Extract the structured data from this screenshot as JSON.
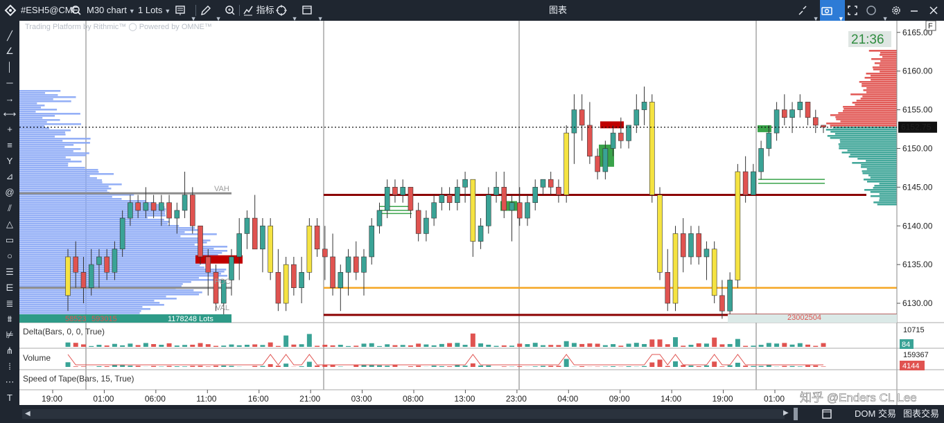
{
  "toolbar": {
    "symbol": "#ESH5@CME",
    "timeframe": "M30 chart",
    "lots": "1 Lots",
    "indicators_label": "指标"
  },
  "window": {
    "title": "图表"
  },
  "chart": {
    "watermark": "Trading Platform by Rithmic™  ◯ Powered by OMNE™",
    "f_label": "F",
    "bar_timer": "21:36",
    "current_price_label": "6152.75",
    "current_price": 6152.75,
    "price_axis": {
      "min": 6127.5,
      "max": 6166.5,
      "ticks": [
        "6165.00",
        "6160.00",
        "6155.00",
        "6150.00",
        "6145.00",
        "6140.00",
        "6135.00",
        "6130.00"
      ]
    },
    "time_axis": [
      "19:00",
      "01:00",
      "06:00",
      "11:00",
      "16:00",
      "21:00",
      "03:00",
      "08:00",
      "13:00",
      "23:00",
      "04:00",
      "09:00",
      "14:00",
      "19:00",
      "01:00"
    ],
    "profile_labels": {
      "vah": "VAH",
      "poc": "POC",
      "val": "VAL"
    },
    "profile_footer": {
      "left": "58523",
      "right": "1178248 Lots"
    },
    "session_footer": "23002504",
    "levels": [
      {
        "name": "VAH",
        "price": 6144.0,
        "color": "#8c8c8c"
      },
      {
        "name": "POC",
        "price": 6132.0,
        "color": "#8c8c8c"
      },
      {
        "name": "res-1",
        "price": 6144.0,
        "color": "#8b0000"
      },
      {
        "name": "sup-1",
        "price": 6128.5,
        "color": "#8b0000"
      },
      {
        "name": "orange",
        "price": 6132.0,
        "color": "#f5a623"
      }
    ],
    "colors": {
      "up": "#3aa396",
      "down": "#e05350",
      "yellow": "#f5e342",
      "profile": "#8aa7f5"
    }
  },
  "chart_data": {
    "type": "candlestick",
    "title": "#ESH5@CME M30 chart",
    "ylim": [
      6127.5,
      6166.5
    ],
    "candles": [
      {
        "t": "19:00",
        "o": 6131,
        "h": 6137,
        "l": 6129,
        "c": 6136
      },
      {
        "t": "19:30",
        "o": 6136,
        "h": 6138,
        "l": 6132,
        "c": 6134
      },
      {
        "t": "20:00",
        "o": 6134,
        "h": 6136,
        "l": 6130,
        "c": 6132
      },
      {
        "t": "20:30",
        "o": 6132,
        "h": 6137,
        "l": 6131,
        "c": 6135
      },
      {
        "t": "21:00",
        "o": 6135,
        "h": 6137,
        "l": 6132,
        "c": 6136
      },
      {
        "t": "21:30",
        "o": 6136,
        "h": 6137,
        "l": 6133,
        "c": 6134
      },
      {
        "t": "22:00",
        "o": 6134,
        "h": 6138,
        "l": 6133,
        "c": 6137
      },
      {
        "t": "22:30",
        "o": 6137,
        "h": 6142,
        "l": 6136,
        "c": 6141
      },
      {
        "t": "23:00",
        "o": 6141,
        "h": 6144,
        "l": 6140,
        "c": 6143
      },
      {
        "t": "23:30",
        "o": 6143,
        "h": 6144,
        "l": 6141,
        "c": 6142
      },
      {
        "t": "00:00",
        "o": 6142,
        "h": 6145,
        "l": 6141,
        "c": 6143
      },
      {
        "t": "00:30",
        "o": 6143,
        "h": 6144,
        "l": 6141,
        "c": 6142
      },
      {
        "t": "01:00",
        "o": 6142,
        "h": 6144,
        "l": 6140,
        "c": 6143
      },
      {
        "t": "01:30",
        "o": 6143,
        "h": 6144,
        "l": 6140,
        "c": 6141
      },
      {
        "t": "02:00",
        "o": 6141,
        "h": 6143,
        "l": 6139,
        "c": 6142
      },
      {
        "t": "02:30",
        "o": 6142,
        "h": 6147,
        "l": 6141,
        "c": 6144
      },
      {
        "t": "03:00",
        "o": 6144,
        "h": 6145,
        "l": 6139,
        "c": 6140
      },
      {
        "t": "03:30",
        "o": 6140,
        "h": 6140,
        "l": 6135,
        "c": 6136
      },
      {
        "t": "04:00",
        "o": 6136,
        "h": 6137,
        "l": 6131,
        "c": 6134
      },
      {
        "t": "04:30",
        "o": 6134,
        "h": 6135,
        "l": 6129,
        "c": 6130
      },
      {
        "t": "05:00",
        "o": 6130,
        "h": 6133,
        "l": 6128,
        "c": 6133
      },
      {
        "t": "05:30",
        "o": 6133,
        "h": 6137,
        "l": 6131,
        "c": 6136
      },
      {
        "t": "06:00",
        "o": 6136,
        "h": 6141,
        "l": 6133,
        "c": 6139
      },
      {
        "t": "06:30",
        "o": 6139,
        "h": 6142,
        "l": 6137,
        "c": 6141
      },
      {
        "t": "07:00",
        "o": 6141,
        "h": 6144,
        "l": 6137,
        "c": 6137
      },
      {
        "t": "07:30",
        "o": 6137,
        "h": 6141,
        "l": 6134,
        "c": 6140
      },
      {
        "t": "08:00",
        "o": 6140,
        "h": 6141,
        "l": 6133,
        "c": 6134
      },
      {
        "t": "08:30",
        "o": 6134,
        "h": 6137,
        "l": 6129,
        "c": 6130
      },
      {
        "t": "09:00",
        "o": 6130,
        "h": 6136,
        "l": 6129,
        "c": 6135
      },
      {
        "t": "09:30",
        "o": 6135,
        "h": 6136,
        "l": 6131,
        "c": 6132
      },
      {
        "t": "10:00",
        "o": 6132,
        "h": 6136,
        "l": 6130,
        "c": 6134
      },
      {
        "t": "10:30",
        "o": 6134,
        "h": 6141,
        "l": 6133,
        "c": 6140
      },
      {
        "t": "11:00",
        "o": 6140,
        "h": 6141,
        "l": 6136,
        "c": 6137
      },
      {
        "t": "11:30",
        "o": 6137,
        "h": 6140,
        "l": 6133,
        "c": 6136
      },
      {
        "t": "12:00",
        "o": 6136,
        "h": 6139,
        "l": 6131,
        "c": 6132
      },
      {
        "t": "12:30",
        "o": 6132,
        "h": 6135,
        "l": 6129,
        "c": 6134
      },
      {
        "t": "13:00",
        "o": 6134,
        "h": 6137,
        "l": 6131,
        "c": 6136
      },
      {
        "t": "13:30",
        "o": 6136,
        "h": 6138,
        "l": 6133,
        "c": 6134
      },
      {
        "t": "14:00",
        "o": 6134,
        "h": 6137,
        "l": 6131,
        "c": 6136
      },
      {
        "t": "14:30",
        "o": 6136,
        "h": 6141,
        "l": 6135,
        "c": 6140
      },
      {
        "t": "15:00",
        "o": 6140,
        "h": 6143,
        "l": 6139,
        "c": 6142
      },
      {
        "t": "15:30",
        "o": 6142,
        "h": 6146,
        "l": 6141,
        "c": 6145
      },
      {
        "t": "16:00",
        "o": 6145,
        "h": 6146,
        "l": 6143,
        "c": 6144
      },
      {
        "t": "16:30",
        "o": 6144,
        "h": 6146,
        "l": 6143,
        "c": 6145
      },
      {
        "t": "17:00",
        "o": 6145,
        "h": 6145,
        "l": 6141,
        "c": 6142
      },
      {
        "t": "17:30",
        "o": 6142,
        "h": 6143,
        "l": 6138,
        "c": 6139
      },
      {
        "t": "18:00",
        "o": 6139,
        "h": 6142,
        "l": 6138,
        "c": 6141
      },
      {
        "t": "18:30",
        "o": 6141,
        "h": 6144,
        "l": 6140,
        "c": 6143
      },
      {
        "t": "19:00",
        "o": 6143,
        "h": 6145,
        "l": 6142,
        "c": 6144
      },
      {
        "t": "19:30",
        "o": 6144,
        "h": 6145,
        "l": 6142,
        "c": 6143
      },
      {
        "t": "20:00",
        "o": 6143,
        "h": 6146,
        "l": 6142,
        "c": 6145
      },
      {
        "t": "20:30",
        "o": 6145,
        "h": 6147,
        "l": 6143,
        "c": 6146
      },
      {
        "t": "21:00",
        "o": 6146,
        "h": 6146,
        "l": 6136,
        "c": 6138
      },
      {
        "t": "21:30",
        "o": 6138,
        "h": 6141,
        "l": 6137,
        "c": 6140
      },
      {
        "t": "22:00",
        "o": 6140,
        "h": 6145,
        "l": 6139,
        "c": 6144
      },
      {
        "t": "22:30",
        "o": 6144,
        "h": 6147,
        "l": 6143,
        "c": 6145
      },
      {
        "t": "23:00",
        "o": 6145,
        "h": 6147,
        "l": 6141,
        "c": 6142
      },
      {
        "t": "23:30",
        "o": 6142,
        "h": 6144,
        "l": 6138,
        "c": 6143
      },
      {
        "t": "00:00",
        "o": 6143,
        "h": 6145,
        "l": 6140,
        "c": 6141
      },
      {
        "t": "00:30",
        "o": 6141,
        "h": 6144,
        "l": 6140,
        "c": 6143
      },
      {
        "t": "01:00",
        "o": 6143,
        "h": 6146,
        "l": 6142,
        "c": 6145
      },
      {
        "t": "01:30",
        "o": 6145,
        "h": 6146,
        "l": 6144,
        "c": 6146
      },
      {
        "t": "02:00",
        "o": 6146,
        "h": 6147,
        "l": 6144,
        "c": 6145
      },
      {
        "t": "02:30",
        "o": 6145,
        "h": 6146,
        "l": 6143,
        "c": 6144
      },
      {
        "t": "03:00",
        "o": 6144,
        "h": 6153,
        "l": 6143,
        "c": 6152
      },
      {
        "t": "03:30",
        "o": 6152,
        "h": 6157,
        "l": 6148,
        "c": 6155
      },
      {
        "t": "04:00",
        "o": 6155,
        "h": 6157,
        "l": 6151,
        "c": 6153
      },
      {
        "t": "04:30",
        "o": 6153,
        "h": 6156,
        "l": 6148,
        "c": 6149
      },
      {
        "t": "05:00",
        "o": 6149,
        "h": 6150,
        "l": 6146,
        "c": 6147
      },
      {
        "t": "05:30",
        "o": 6147,
        "h": 6151,
        "l": 6146,
        "c": 6150
      },
      {
        "t": "06:00",
        "o": 6150,
        "h": 6153,
        "l": 6149,
        "c": 6152
      },
      {
        "t": "06:30",
        "o": 6152,
        "h": 6154,
        "l": 6150,
        "c": 6151
      },
      {
        "t": "07:00",
        "o": 6151,
        "h": 6153,
        "l": 6150,
        "c": 6153
      },
      {
        "t": "07:30",
        "o": 6153,
        "h": 6157,
        "l": 6152,
        "c": 6155
      },
      {
        "t": "08:00",
        "o": 6155,
        "h": 6158,
        "l": 6153,
        "c": 6156
      },
      {
        "t": "08:30",
        "o": 6156,
        "h": 6157,
        "l": 6143,
        "c": 6144
      },
      {
        "t": "09:00",
        "o": 6144,
        "h": 6145,
        "l": 6133,
        "c": 6134
      },
      {
        "t": "09:30",
        "o": 6134,
        "h": 6137,
        "l": 6129,
        "c": 6130
      },
      {
        "t": "10:00",
        "o": 6130,
        "h": 6140,
        "l": 6129,
        "c": 6139
      },
      {
        "t": "10:30",
        "o": 6139,
        "h": 6141,
        "l": 6134,
        "c": 6136
      },
      {
        "t": "11:00",
        "o": 6136,
        "h": 6140,
        "l": 6135,
        "c": 6139
      },
      {
        "t": "11:30",
        "o": 6139,
        "h": 6140,
        "l": 6135,
        "c": 6136
      },
      {
        "t": "12:00",
        "o": 6136,
        "h": 6138,
        "l": 6133,
        "c": 6137
      },
      {
        "t": "12:30",
        "o": 6137,
        "h": 6138,
        "l": 6130,
        "c": 6131
      },
      {
        "t": "13:00",
        "o": 6131,
        "h": 6133,
        "l": 6128,
        "c": 6129
      },
      {
        "t": "13:30",
        "o": 6129,
        "h": 6134,
        "l": 6128,
        "c": 6133
      },
      {
        "t": "14:00",
        "o": 6133,
        "h": 6148,
        "l": 6132,
        "c": 6147
      },
      {
        "t": "14:30",
        "o": 6147,
        "h": 6149,
        "l": 6143,
        "c": 6144
      },
      {
        "t": "15:00",
        "o": 6144,
        "h": 6148,
        "l": 6144,
        "c": 6147
      },
      {
        "t": "15:30",
        "o": 6147,
        "h": 6151,
        "l": 6146,
        "c": 6150
      },
      {
        "t": "16:00",
        "o": 6150,
        "h": 6153,
        "l": 6149,
        "c": 6152
      },
      {
        "t": "16:30",
        "o": 6152,
        "h": 6156,
        "l": 6151,
        "c": 6155
      },
      {
        "t": "17:00",
        "o": 6155,
        "h": 6157,
        "l": 6153,
        "c": 6154
      },
      {
        "t": "17:30",
        "o": 6154,
        "h": 6156,
        "l": 6152,
        "c": 6155
      },
      {
        "t": "18:00",
        "o": 6155,
        "h": 6157,
        "l": 6154,
        "c": 6156
      },
      {
        "t": "18:30",
        "o": 6156,
        "h": 6156,
        "l": 6153,
        "c": 6154
      },
      {
        "t": "19:00",
        "o": 6154,
        "h": 6155,
        "l": 6152,
        "c": 6153
      },
      {
        "t": "19:30",
        "o": 6153,
        "h": 6153,
        "l": 6152,
        "c": 6152.75
      }
    ],
    "delta_ylabel": "Delta(Bars, 0, 0, True)",
    "delta_value": "84",
    "delta_max": "10715",
    "volume_ylabel": "Volume",
    "volume_value": "4144",
    "volume_max": "159367",
    "speed_label": "Speed of Tape(Bars, 15, True)"
  },
  "bottom": {
    "dom_label": "DOM 交易",
    "chart_trade_label": "图表交易",
    "watermark": "知乎 @Enders CL Lee"
  }
}
